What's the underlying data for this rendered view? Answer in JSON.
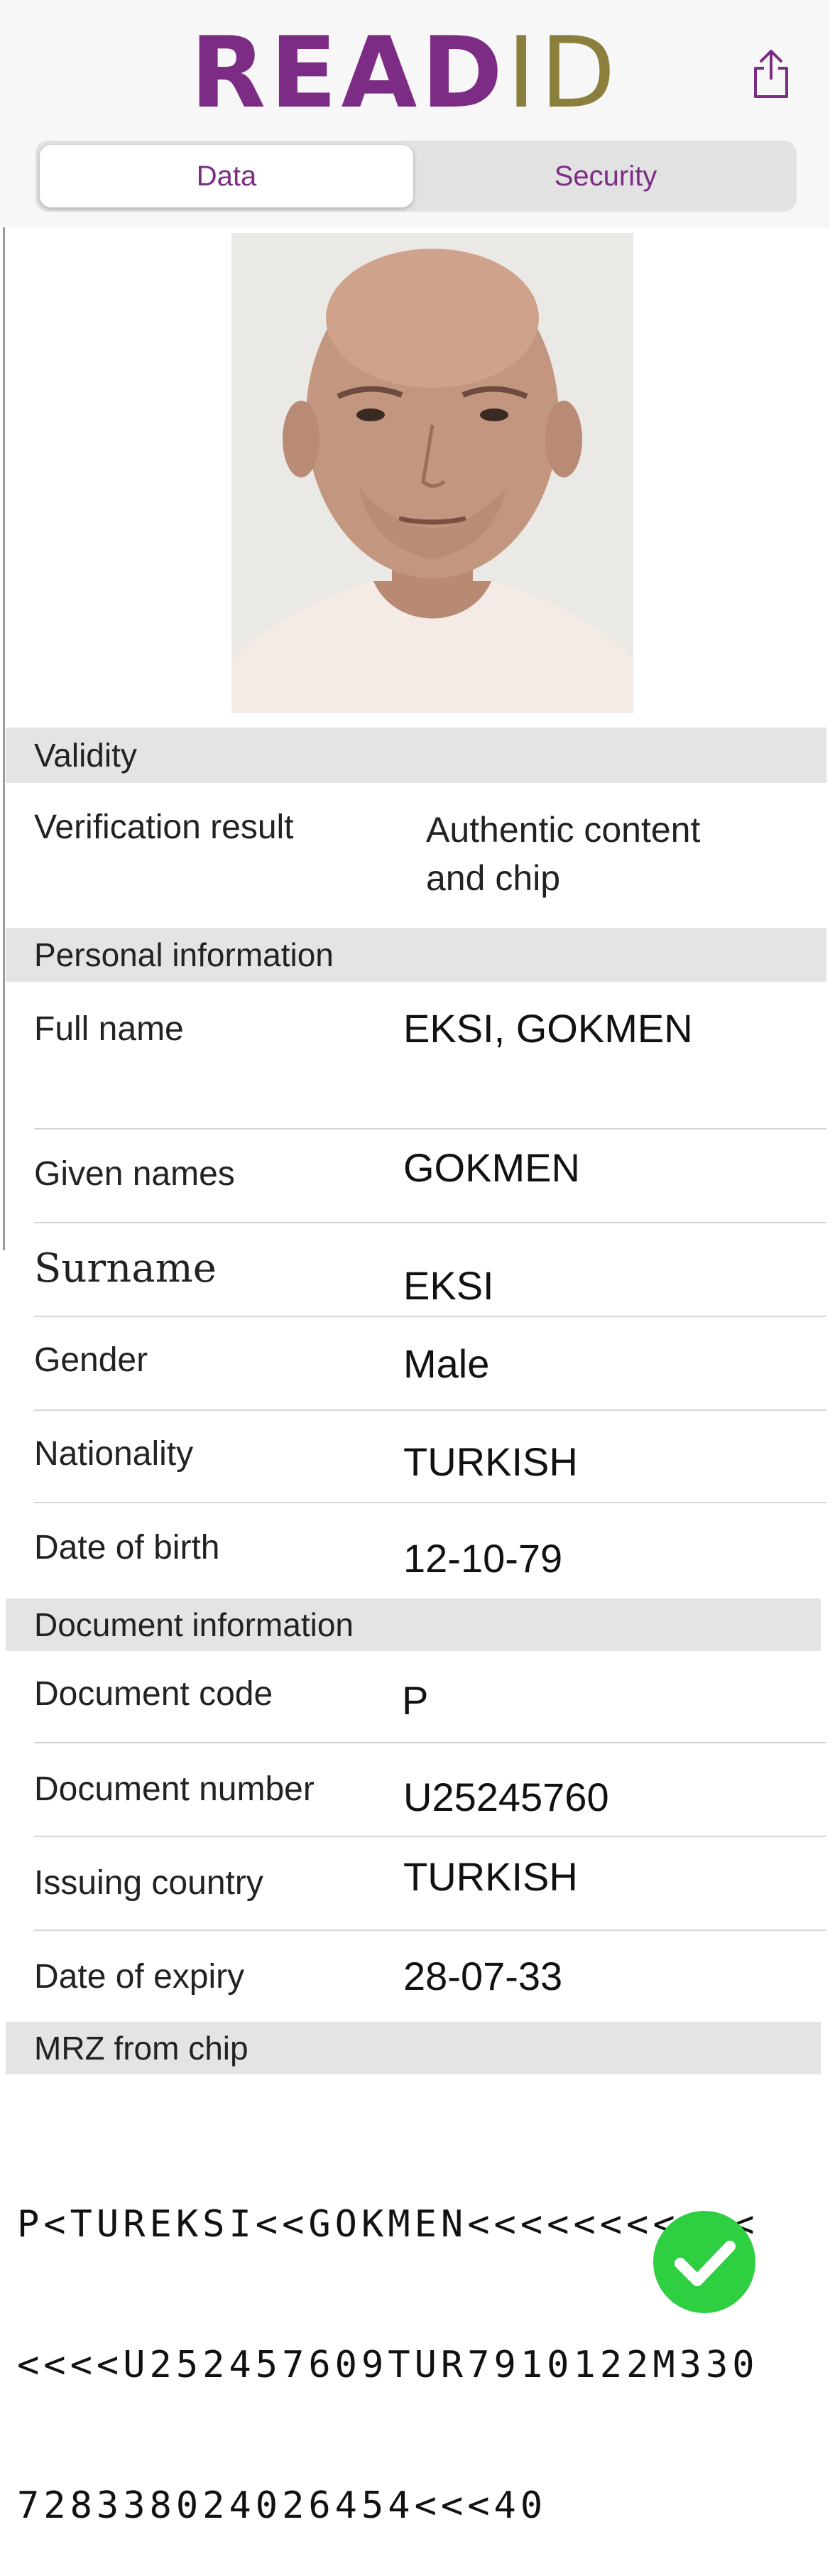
{
  "header": {
    "logo_main": "READ",
    "logo_tail": "ID",
    "share_icon": "share-icon",
    "tabs": [
      {
        "label": "Data",
        "active": true
      },
      {
        "label": "Security",
        "active": false
      }
    ]
  },
  "photo": {
    "alt": "Document holder portrait"
  },
  "validity": {
    "title": "Validity",
    "verification_label": "Verification result",
    "verification_value_line1": "Authentic content",
    "verification_value_line2": "and chip"
  },
  "personal": {
    "title": "Personal information",
    "rows": [
      {
        "label": "Full name",
        "value": "EKSI, GOKMEN"
      },
      {
        "label": "Given names",
        "value": "GOKMEN"
      },
      {
        "label": "Surname",
        "value": "EKSI"
      },
      {
        "label": "Gender",
        "value": "Male"
      },
      {
        "label": "Nationality",
        "value": "TURKISH"
      },
      {
        "label": "Date of birth",
        "value": "12-10-79"
      }
    ]
  },
  "document": {
    "title": "Document information",
    "rows": [
      {
        "label": "Document code",
        "value": "P"
      },
      {
        "label": "Document number",
        "value": "U25245760"
      },
      {
        "label": "Issuing country",
        "value": "TURKISH"
      },
      {
        "label": "Date of expiry",
        "value": "28-07-33"
      }
    ]
  },
  "mrz": {
    "title": "MRZ from chip",
    "lines": [
      "P<TUREKSI<<GOKMEN<<<<<<<<<<<",
      "<<<<U252457609TUR7910122M330",
      "728338024026454<<<40"
    ]
  },
  "status": {
    "icon": "checkmark-icon",
    "color": "#2fcf42"
  },
  "colors": {
    "brand": "#7d2c86",
    "logo_tail": "#8a7f3c",
    "band": "#e4e4e4"
  }
}
